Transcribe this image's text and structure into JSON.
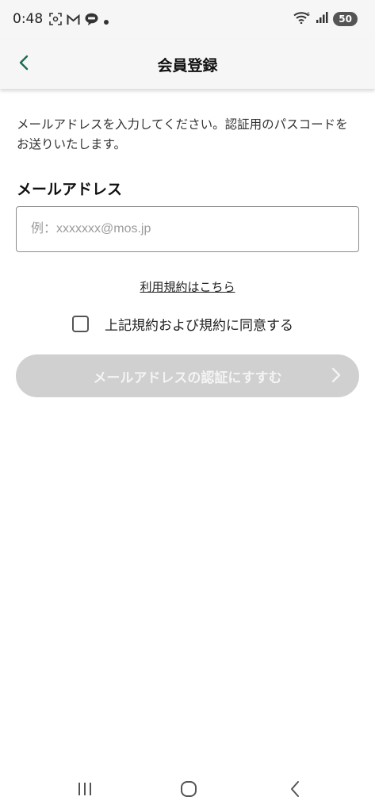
{
  "status_bar": {
    "time": "0:48",
    "battery": "50",
    "icons_left": [
      "screenshot-icon",
      "gmail-icon",
      "line-icon",
      "dot-icon"
    ],
    "icons_right": [
      "wifi-icon",
      "signal-icon",
      "battery-icon"
    ]
  },
  "header": {
    "title": "会員登録",
    "back_icon": "chevron-left-icon",
    "accent_color": "#1a6b4f"
  },
  "content": {
    "intro": "メールアドレスを入力してください。認証用のパスコードをお送りいたします。",
    "email_label": "メールアドレス",
    "email_placeholder": "例：xxxxxxx@mos.jp",
    "email_value": "",
    "terms_link": "利用規約はこちら",
    "agree_label": "上記規約および規約に同意する",
    "agree_checked": false,
    "submit_label": "メールアドレスの認証にすすむ",
    "submit_disabled_color": "#d0d0d0"
  },
  "nav_bar": {
    "icons": [
      "recent-apps-icon",
      "home-icon",
      "back-icon"
    ]
  }
}
